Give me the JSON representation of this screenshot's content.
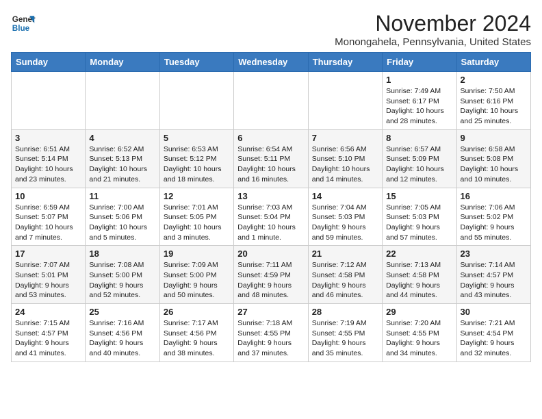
{
  "logo": {
    "line1": "General",
    "line2": "Blue"
  },
  "title": "November 2024",
  "location": "Monongahela, Pennsylvania, United States",
  "days_of_week": [
    "Sunday",
    "Monday",
    "Tuesday",
    "Wednesday",
    "Thursday",
    "Friday",
    "Saturday"
  ],
  "weeks": [
    [
      {
        "day": "",
        "info": ""
      },
      {
        "day": "",
        "info": ""
      },
      {
        "day": "",
        "info": ""
      },
      {
        "day": "",
        "info": ""
      },
      {
        "day": "",
        "info": ""
      },
      {
        "day": "1",
        "info": "Sunrise: 7:49 AM\nSunset: 6:17 PM\nDaylight: 10 hours\nand 28 minutes."
      },
      {
        "day": "2",
        "info": "Sunrise: 7:50 AM\nSunset: 6:16 PM\nDaylight: 10 hours\nand 25 minutes."
      }
    ],
    [
      {
        "day": "3",
        "info": "Sunrise: 6:51 AM\nSunset: 5:14 PM\nDaylight: 10 hours\nand 23 minutes."
      },
      {
        "day": "4",
        "info": "Sunrise: 6:52 AM\nSunset: 5:13 PM\nDaylight: 10 hours\nand 21 minutes."
      },
      {
        "day": "5",
        "info": "Sunrise: 6:53 AM\nSunset: 5:12 PM\nDaylight: 10 hours\nand 18 minutes."
      },
      {
        "day": "6",
        "info": "Sunrise: 6:54 AM\nSunset: 5:11 PM\nDaylight: 10 hours\nand 16 minutes."
      },
      {
        "day": "7",
        "info": "Sunrise: 6:56 AM\nSunset: 5:10 PM\nDaylight: 10 hours\nand 14 minutes."
      },
      {
        "day": "8",
        "info": "Sunrise: 6:57 AM\nSunset: 5:09 PM\nDaylight: 10 hours\nand 12 minutes."
      },
      {
        "day": "9",
        "info": "Sunrise: 6:58 AM\nSunset: 5:08 PM\nDaylight: 10 hours\nand 10 minutes."
      }
    ],
    [
      {
        "day": "10",
        "info": "Sunrise: 6:59 AM\nSunset: 5:07 PM\nDaylight: 10 hours\nand 7 minutes."
      },
      {
        "day": "11",
        "info": "Sunrise: 7:00 AM\nSunset: 5:06 PM\nDaylight: 10 hours\nand 5 minutes."
      },
      {
        "day": "12",
        "info": "Sunrise: 7:01 AM\nSunset: 5:05 PM\nDaylight: 10 hours\nand 3 minutes."
      },
      {
        "day": "13",
        "info": "Sunrise: 7:03 AM\nSunset: 5:04 PM\nDaylight: 10 hours\nand 1 minute."
      },
      {
        "day": "14",
        "info": "Sunrise: 7:04 AM\nSunset: 5:03 PM\nDaylight: 9 hours\nand 59 minutes."
      },
      {
        "day": "15",
        "info": "Sunrise: 7:05 AM\nSunset: 5:03 PM\nDaylight: 9 hours\nand 57 minutes."
      },
      {
        "day": "16",
        "info": "Sunrise: 7:06 AM\nSunset: 5:02 PM\nDaylight: 9 hours\nand 55 minutes."
      }
    ],
    [
      {
        "day": "17",
        "info": "Sunrise: 7:07 AM\nSunset: 5:01 PM\nDaylight: 9 hours\nand 53 minutes."
      },
      {
        "day": "18",
        "info": "Sunrise: 7:08 AM\nSunset: 5:00 PM\nDaylight: 9 hours\nand 52 minutes."
      },
      {
        "day": "19",
        "info": "Sunrise: 7:09 AM\nSunset: 5:00 PM\nDaylight: 9 hours\nand 50 minutes."
      },
      {
        "day": "20",
        "info": "Sunrise: 7:11 AM\nSunset: 4:59 PM\nDaylight: 9 hours\nand 48 minutes."
      },
      {
        "day": "21",
        "info": "Sunrise: 7:12 AM\nSunset: 4:58 PM\nDaylight: 9 hours\nand 46 minutes."
      },
      {
        "day": "22",
        "info": "Sunrise: 7:13 AM\nSunset: 4:58 PM\nDaylight: 9 hours\nand 44 minutes."
      },
      {
        "day": "23",
        "info": "Sunrise: 7:14 AM\nSunset: 4:57 PM\nDaylight: 9 hours\nand 43 minutes."
      }
    ],
    [
      {
        "day": "24",
        "info": "Sunrise: 7:15 AM\nSunset: 4:57 PM\nDaylight: 9 hours\nand 41 minutes."
      },
      {
        "day": "25",
        "info": "Sunrise: 7:16 AM\nSunset: 4:56 PM\nDaylight: 9 hours\nand 40 minutes."
      },
      {
        "day": "26",
        "info": "Sunrise: 7:17 AM\nSunset: 4:56 PM\nDaylight: 9 hours\nand 38 minutes."
      },
      {
        "day": "27",
        "info": "Sunrise: 7:18 AM\nSunset: 4:55 PM\nDaylight: 9 hours\nand 37 minutes."
      },
      {
        "day": "28",
        "info": "Sunrise: 7:19 AM\nSunset: 4:55 PM\nDaylight: 9 hours\nand 35 minutes."
      },
      {
        "day": "29",
        "info": "Sunrise: 7:20 AM\nSunset: 4:55 PM\nDaylight: 9 hours\nand 34 minutes."
      },
      {
        "day": "30",
        "info": "Sunrise: 7:21 AM\nSunset: 4:54 PM\nDaylight: 9 hours\nand 32 minutes."
      }
    ]
  ]
}
